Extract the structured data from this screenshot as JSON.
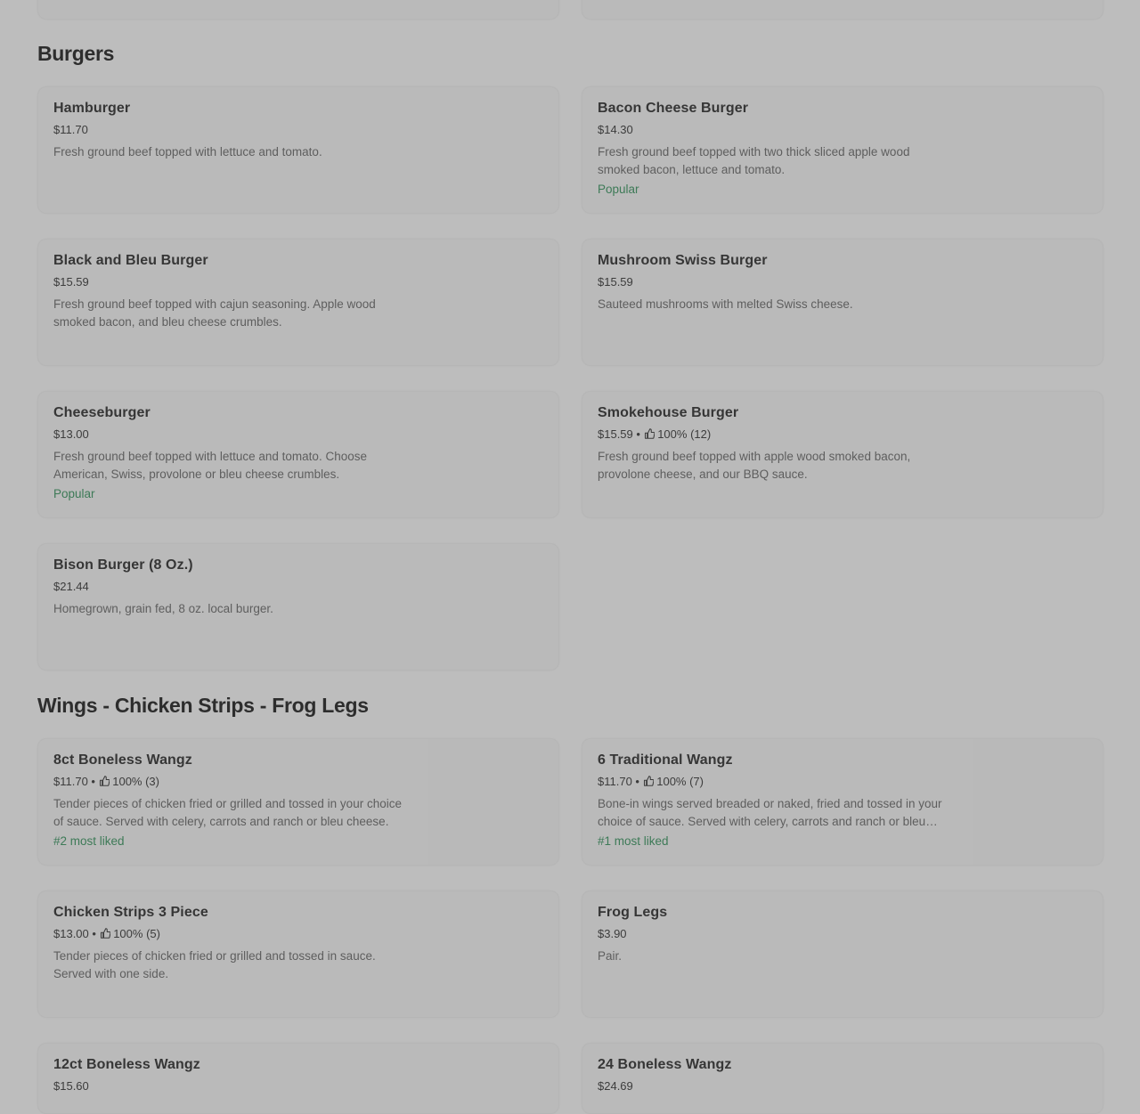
{
  "sections": [
    {
      "title": "Burgers",
      "items": [
        {
          "name": "Hamburger",
          "price": "$11.70",
          "rating": "",
          "description": "Fresh ground beef topped with lettuce and tomato.",
          "badge": ""
        },
        {
          "name": "Bacon Cheese Burger",
          "price": "$14.30",
          "rating": "",
          "description": "Fresh ground beef topped with two thick sliced apple wood smoked bacon, lettuce and tomato.",
          "badge": "Popular"
        },
        {
          "name": "Black and Bleu Burger",
          "price": "$15.59",
          "rating": "",
          "description": "Fresh ground beef topped with cajun seasoning. Apple wood smoked bacon, and bleu cheese crumbles.",
          "badge": ""
        },
        {
          "name": "Mushroom Swiss Burger",
          "price": "$15.59",
          "rating": "",
          "description": "Sauteed mushrooms with melted Swiss cheese.",
          "badge": ""
        },
        {
          "name": "Cheeseburger",
          "price": "$13.00",
          "rating": "",
          "description": "Fresh ground beef topped with lettuce and tomato. Choose American, Swiss, provolone or bleu cheese crumbles.",
          "badge": "Popular"
        },
        {
          "name": "Smokehouse Burger",
          "price": "$15.59",
          "rating": "100% (12)",
          "description": "Fresh ground beef topped with apple wood smoked bacon, provolone cheese, and our BBQ sauce.",
          "badge": ""
        },
        {
          "name": "Bison Burger (8 Oz.)",
          "price": "$21.44",
          "rating": "",
          "description": "Homegrown, grain fed, 8 oz. local burger.",
          "badge": ""
        }
      ]
    },
    {
      "title": "Wings - Chicken Strips - Frog Legs",
      "items": [
        {
          "name": "8ct Boneless Wangz",
          "price": "$11.70",
          "rating": "100% (3)",
          "description": "Tender pieces of chicken fried or grilled and tossed in your choice of sauce. Served with celery, carrots and ranch or bleu cheese.",
          "badge": "#2 most liked"
        },
        {
          "name": "6 Traditional Wangz",
          "price": "$11.70",
          "rating": "100% (7)",
          "description": "Bone-in wings served breaded or naked, fried and tossed in your choice of sauce. Served with celery, carrots and ranch or bleu cheese.",
          "badge": "#1 most liked"
        },
        {
          "name": "Chicken Strips 3 Piece",
          "price": "$13.00",
          "rating": "100% (5)",
          "description": "Tender pieces of chicken fried or grilled and tossed in sauce. Served with one side.",
          "badge": ""
        },
        {
          "name": "Frog Legs",
          "price": "$3.90",
          "rating": "",
          "description": "Pair.",
          "badge": ""
        },
        {
          "name": "12ct Boneless Wangz",
          "price": "$15.60",
          "rating": "",
          "description": "",
          "badge": ""
        },
        {
          "name": "24 Boneless Wangz",
          "price": "$24.69",
          "rating": "",
          "description": "",
          "badge": ""
        }
      ]
    }
  ],
  "rating_separator": "•",
  "icons": {
    "rating": "thumbs-up-icon"
  },
  "colors": {
    "badge": "#3d7a57",
    "background": "#bdbdbd"
  }
}
